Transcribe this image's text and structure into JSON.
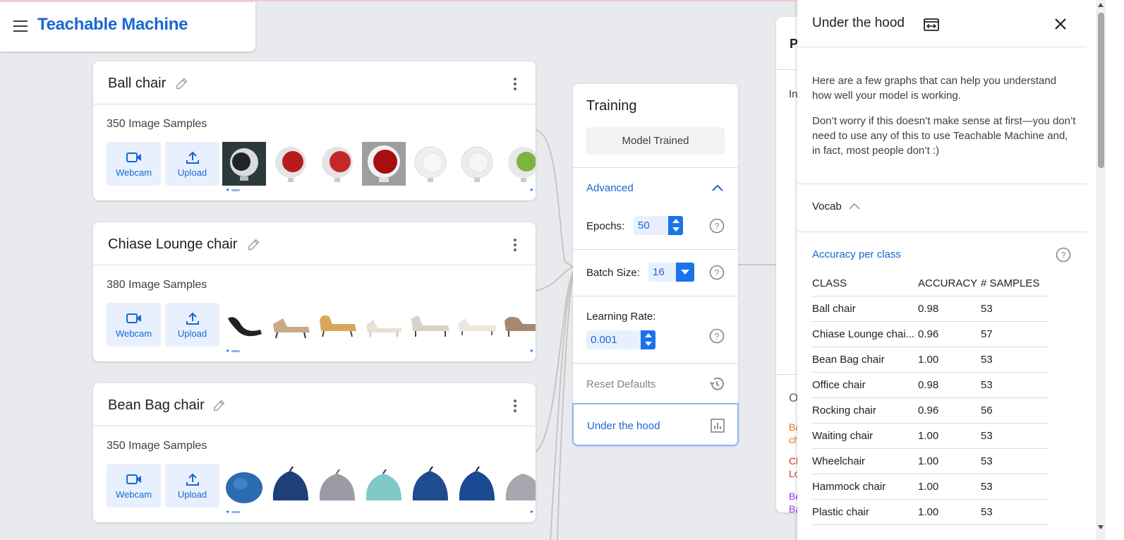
{
  "app": {
    "title": "Teachable Machine"
  },
  "classes": [
    {
      "name": "Ball chair",
      "samples": "350 Image Samples",
      "webcam_label": "Webcam",
      "upload_label": "Upload"
    },
    {
      "name": "Chiase Lounge chair",
      "samples": "380 Image Samples",
      "webcam_label": "Webcam",
      "upload_label": "Upload"
    },
    {
      "name": "Bean Bag chair",
      "samples": "350 Image Samples",
      "webcam_label": "Webcam",
      "upload_label": "Upload"
    }
  ],
  "training": {
    "title": "Training",
    "model_button": "Model Trained",
    "advanced_label": "Advanced",
    "epochs_label": "Epochs:",
    "epochs_value": "50",
    "batch_label": "Batch Size:",
    "batch_value": "16",
    "lr_label": "Learning Rate:",
    "lr_value": "0.001",
    "reset_label": "Reset Defaults",
    "under_hood_label": "Under the hood"
  },
  "preview": {
    "title": "P",
    "input_label": "In",
    "output_label": "O",
    "lines": [
      {
        "text": "Ba",
        "color": "#e8710a"
      },
      {
        "text": "ch",
        "color": "#e8710a"
      },
      {
        "text": "Ch",
        "color": "#d93025"
      },
      {
        "text": "Lo",
        "color": "#d93025"
      },
      {
        "text": "Be",
        "color": "#9334e6"
      },
      {
        "text": "Ba",
        "color": "#9334e6"
      }
    ]
  },
  "side_panel": {
    "title": "Under the hood",
    "intro1": "Here are a few graphs that can help you understand how well your model is working.",
    "intro2": "Don’t worry if this doesn’t make sense at first—you don’t need to use any of this to use Teachable Machine and, in fact, most people don’t :)",
    "vocab_label": "Vocab",
    "accuracy_title": "Accuracy per class",
    "table_headers": [
      "CLASS",
      "ACCURACY",
      "# SAMPLES"
    ],
    "table_rows": [
      [
        "Ball chair",
        "0.98",
        "53"
      ],
      [
        "Chiase Lounge chai...",
        "0.96",
        "57"
      ],
      [
        "Bean Bag chair",
        "1.00",
        "53"
      ],
      [
        "Office chair",
        "0.98",
        "53"
      ],
      [
        "Rocking chair",
        "0.96",
        "56"
      ],
      [
        "Waiting chair",
        "1.00",
        "53"
      ],
      [
        "Wheelchair",
        "1.00",
        "53"
      ],
      [
        "Hammock chair",
        "1.00",
        "53"
      ],
      [
        "Plastic chair",
        "1.00",
        "53"
      ]
    ]
  },
  "colors": {
    "brand": "#1967d2",
    "accent": "#1a73e8",
    "button_bg": "#e8f0fe"
  }
}
